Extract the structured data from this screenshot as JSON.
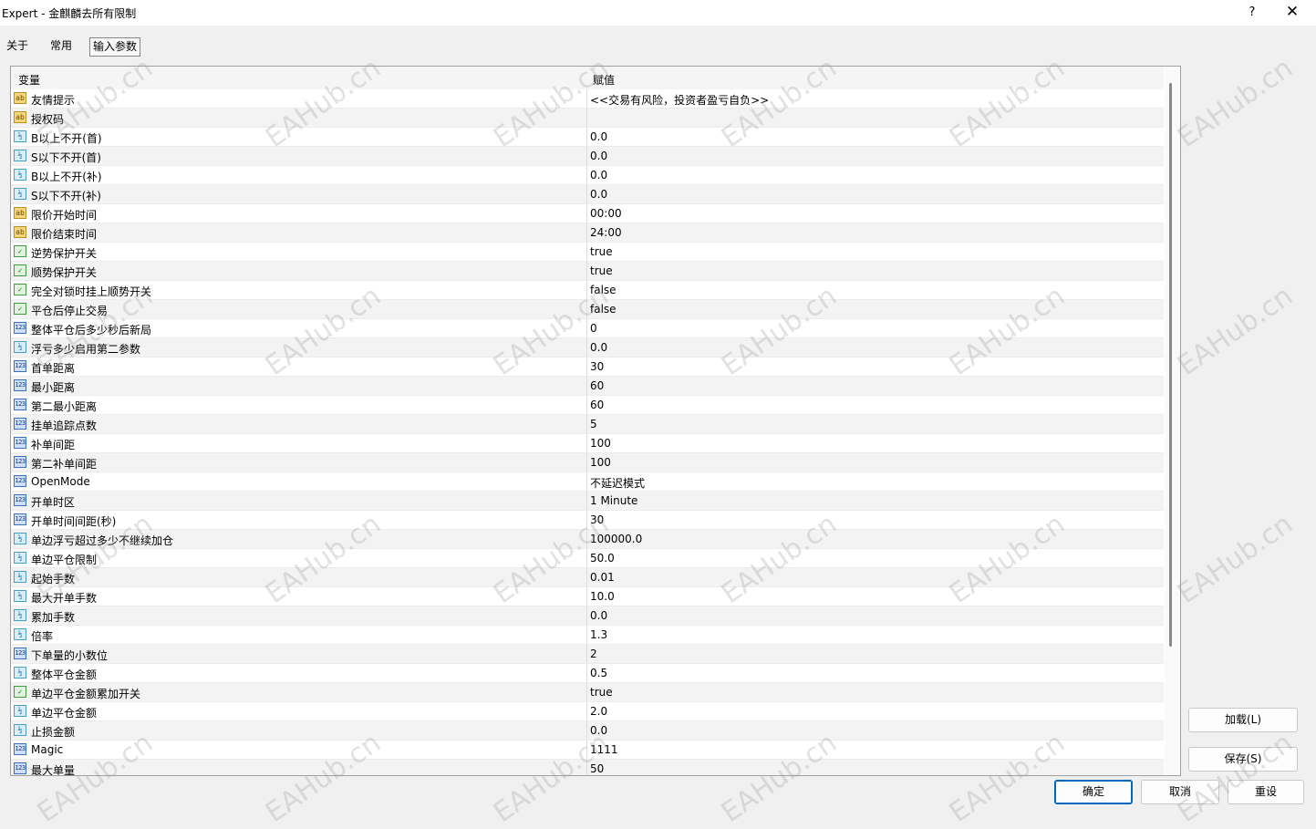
{
  "window": {
    "title": "Expert - 金麒麟去所有限制",
    "help": "?",
    "close": "✕"
  },
  "tabs": [
    "关于",
    "常用",
    "输入参数"
  ],
  "table": {
    "headers": [
      "变量",
      "赋值"
    ],
    "rows": [
      {
        "type": "ab",
        "name": "友情提示",
        "value": "<<交易有风险，投资者盈亏自负>>"
      },
      {
        "type": "ab",
        "name": "授权码",
        "value": ""
      },
      {
        "type": "dbl",
        "name": "B以上不开(首)",
        "value": "0.0"
      },
      {
        "type": "dbl",
        "name": "S以下不开(首)",
        "value": "0.0"
      },
      {
        "type": "dbl",
        "name": "B以上不开(补)",
        "value": "0.0"
      },
      {
        "type": "dbl",
        "name": "S以下不开(补)",
        "value": "0.0"
      },
      {
        "type": "ab",
        "name": "限价开始时间",
        "value": "00:00"
      },
      {
        "type": "ab",
        "name": "限价结束时间",
        "value": "24:00"
      },
      {
        "type": "bool",
        "name": "逆势保护开关",
        "value": "true"
      },
      {
        "type": "bool",
        "name": "顺势保护开关",
        "value": "true"
      },
      {
        "type": "bool",
        "name": "完全对锁时挂上顺势开关",
        "value": "false"
      },
      {
        "type": "bool",
        "name": "平仓后停止交易",
        "value": "false"
      },
      {
        "type": "int",
        "name": "整体平仓后多少秒后新局",
        "value": "0"
      },
      {
        "type": "dbl",
        "name": "浮亏多少启用第二参数",
        "value": "0.0"
      },
      {
        "type": "int",
        "name": "首单距离",
        "value": "30"
      },
      {
        "type": "int",
        "name": "最小距离",
        "value": "60"
      },
      {
        "type": "int",
        "name": "第二最小距离",
        "value": "60"
      },
      {
        "type": "int",
        "name": "挂单追踪点数",
        "value": "5"
      },
      {
        "type": "int",
        "name": "补单间距",
        "value": "100"
      },
      {
        "type": "int",
        "name": "第二补单间距",
        "value": "100"
      },
      {
        "type": "int",
        "name": "OpenMode",
        "value": "不延迟模式"
      },
      {
        "type": "int",
        "name": "开单时区",
        "value": "1 Minute"
      },
      {
        "type": "int",
        "name": "开单时间间距(秒)",
        "value": "30"
      },
      {
        "type": "dbl",
        "name": "单边浮亏超过多少不继续加仓",
        "value": "100000.0"
      },
      {
        "type": "dbl",
        "name": "单边平仓限制",
        "value": "50.0"
      },
      {
        "type": "dbl",
        "name": "起始手数",
        "value": "0.01"
      },
      {
        "type": "dbl",
        "name": "最大开单手数",
        "value": "10.0"
      },
      {
        "type": "dbl",
        "name": "累加手数",
        "value": "0.0"
      },
      {
        "type": "dbl",
        "name": "倍率",
        "value": "1.3"
      },
      {
        "type": "int",
        "name": "下单量的小数位",
        "value": "2"
      },
      {
        "type": "dbl",
        "name": "整体平仓金额",
        "value": "0.5"
      },
      {
        "type": "bool",
        "name": "单边平仓金额累加开关",
        "value": "true"
      },
      {
        "type": "dbl",
        "name": "单边平仓金额",
        "value": "2.0"
      },
      {
        "type": "dbl",
        "name": "止损金额",
        "value": "0.0"
      },
      {
        "type": "int",
        "name": "Magic",
        "value": "1111"
      },
      {
        "type": "int",
        "name": "最大单量",
        "value": "50"
      }
    ]
  },
  "icons": {
    "ab": "ab",
    "dbl": "½",
    "bool": "✓",
    "int": "123"
  },
  "buttons": {
    "load": "加载(L)",
    "save": "保存(S)",
    "ok": "确定",
    "cancel": "取消",
    "reset": "重设"
  },
  "watermark": "EAHub.cn"
}
